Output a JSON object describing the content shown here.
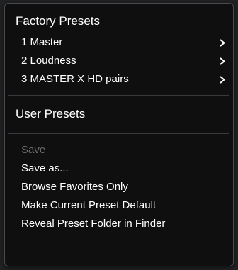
{
  "menu": {
    "factory_header": "Factory Presets",
    "factory_items": [
      {
        "label": "1 Master",
        "has_submenu": true
      },
      {
        "label": "2 Loudness",
        "has_submenu": true
      },
      {
        "label": "3 MASTER X HD pairs",
        "has_submenu": true
      }
    ],
    "user_header": "User Presets",
    "actions": [
      {
        "label": "Save",
        "enabled": false
      },
      {
        "label": "Save as...",
        "enabled": true
      },
      {
        "label": "Browse Favorites Only",
        "enabled": true
      },
      {
        "label": "Make Current Preset Default",
        "enabled": true
      },
      {
        "label": "Reveal Preset Folder in Finder",
        "enabled": true
      }
    ]
  },
  "icons": {
    "submenu": "chevron-right-icon"
  },
  "colors": {
    "menu_background": "#0f0f10",
    "text": "#ffffff",
    "disabled_text": "#6b6b6e",
    "separator": "#3a3a3d"
  }
}
